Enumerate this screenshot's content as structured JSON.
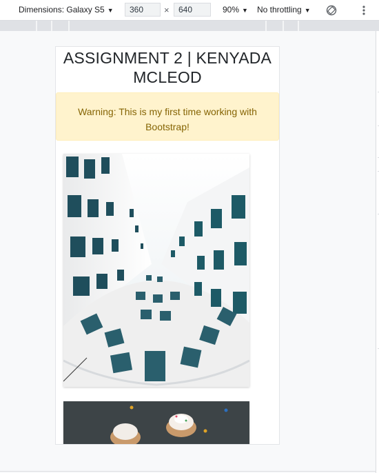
{
  "devtools": {
    "dimensions_label": "Dimensions: Galaxy S5",
    "width_value": "360",
    "height_value": "640",
    "times_symbol": "×",
    "zoom_label": "90%",
    "throttling_label": "No throttling",
    "icons": [
      "caret-down-icon",
      "rotate-icon",
      "more-vert-icon"
    ]
  },
  "page": {
    "title": "ASSIGNMENT 2 | KENYADA MCLEOD",
    "alert_text": "Warning: This is my first time working with Bootstrap!",
    "images": [
      "building-photo",
      "cupcakes-photo"
    ]
  },
  "colors": {
    "alert_bg": "#fff3cd",
    "alert_text": "#856404",
    "title_text": "#212529"
  }
}
